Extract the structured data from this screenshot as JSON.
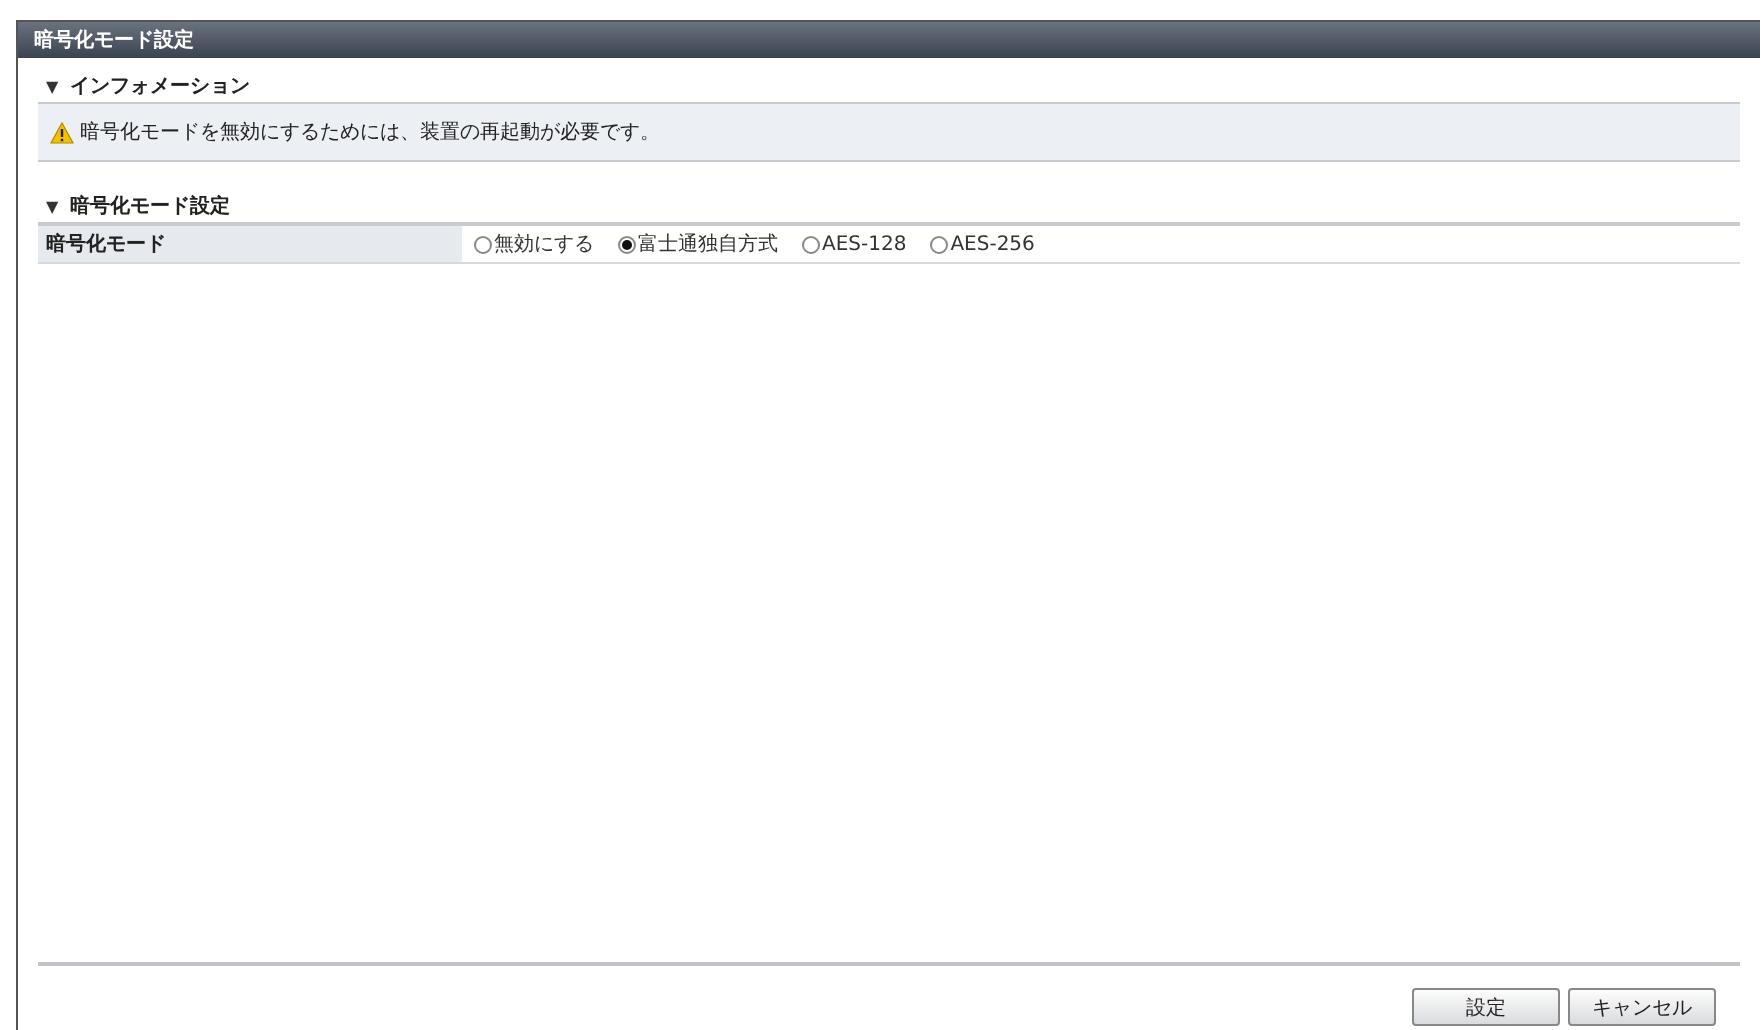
{
  "window": {
    "title": "暗号化モード設定"
  },
  "info": {
    "heading": "インフォメーション",
    "arrow": "▼",
    "message": "暗号化モードを無効にするためには、装置の再起動が必要です。"
  },
  "settings": {
    "heading": "暗号化モード設定",
    "arrow": "▼",
    "label": "暗号化モード",
    "options": [
      {
        "label": "無効にする",
        "selected": false
      },
      {
        "label": "富士通独自方式",
        "selected": true
      },
      {
        "label": "AES-128",
        "selected": false
      },
      {
        "label": "AES-256",
        "selected": false
      }
    ]
  },
  "buttons": [
    "設定",
    "キャンセル"
  ]
}
